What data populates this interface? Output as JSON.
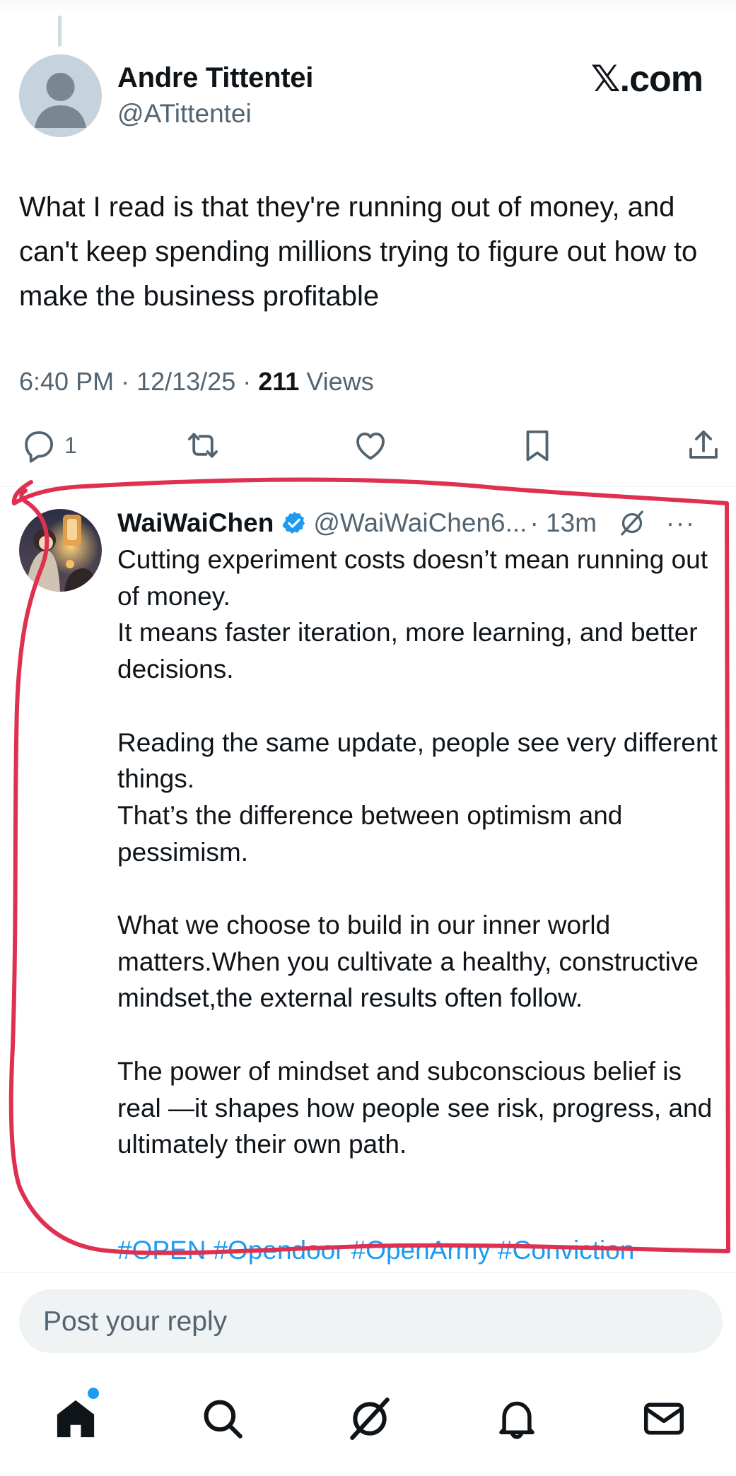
{
  "original_tweet": {
    "author_name": "Andre Tittentei",
    "author_handle": "@ATittentei",
    "site": "𝕏.com",
    "text": "What I read is that they're running out of money, and can't keep spending millions trying to figure out how to make the business profitable",
    "time": "6:40 PM",
    "date": "12/13/25",
    "separator": " · ",
    "views_count": "211",
    "views_label": "Views",
    "actions": {
      "reply_count": "1"
    }
  },
  "reply": {
    "author_name": "WaiWaiChen",
    "author_handle": "@WaiWaiChen6...",
    "time": "· 13m",
    "more_label": "···",
    "verified": true,
    "text": "Cutting experiment costs doesn’t mean running out of money.\nIt means faster iteration, more learning, and better decisions.\n\nReading the same update, people see very different things.\nThat’s the difference between optimism and pessimism.\n\nWhat we choose to build in our inner world matters.When you cultivate a healthy, constructive mindset,the external results often follow.\n\nThe power of mindset and subconscious belief is real —it shapes how people see risk, progress, and ultimately their own path.",
    "hashtags": [
      "#OPEN",
      "#Opendoor",
      "#OpenArmy",
      "#Conviction"
    ]
  },
  "composer": {
    "placeholder": "Post your reply"
  },
  "colors": {
    "accent": "#1d9bf0",
    "secondary_text": "#536471",
    "annotation": "#e03050"
  },
  "tabbar": [
    "home-icon",
    "search-icon",
    "grok-icon",
    "notifications-icon",
    "messages-icon"
  ]
}
